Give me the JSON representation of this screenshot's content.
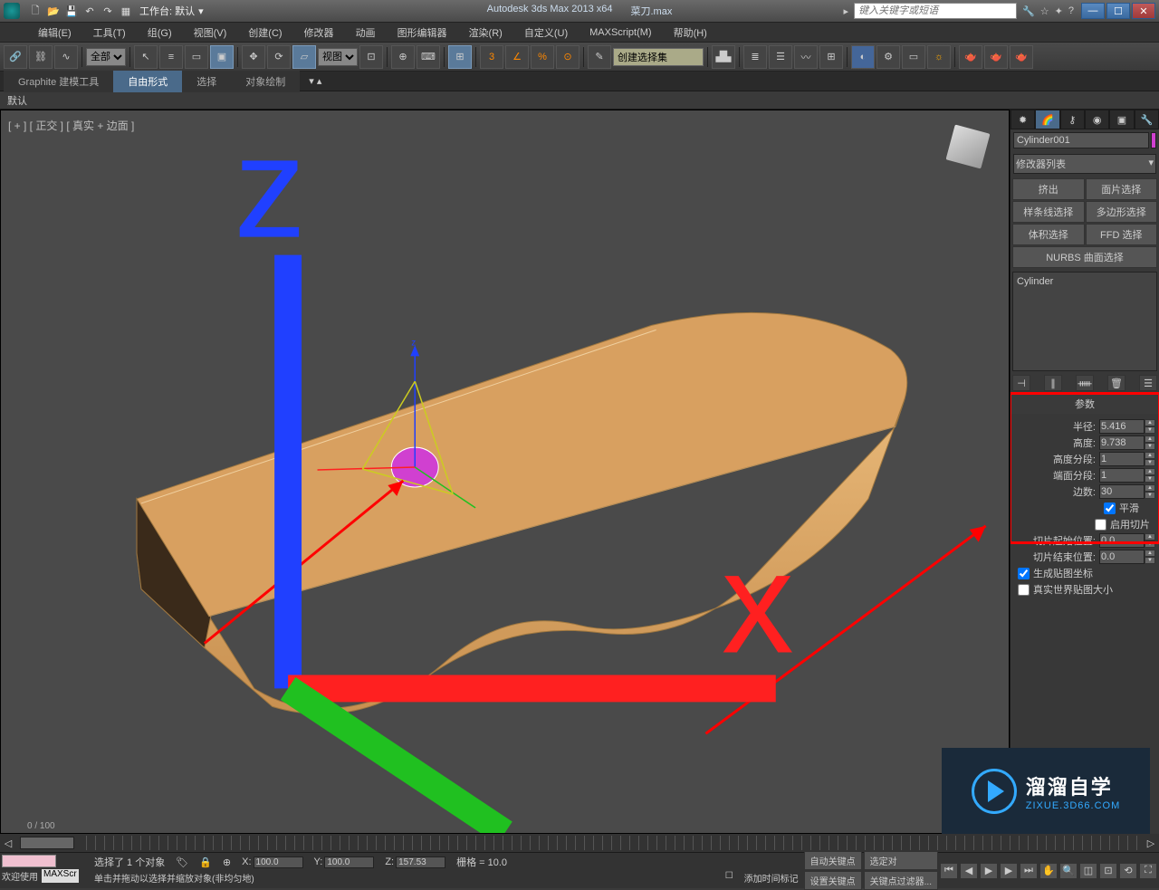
{
  "titlebar": {
    "workspace_label": "工作台: 默认",
    "app_title": "Autodesk 3ds Max  2013 x64",
    "filename": "菜刀.max",
    "search_placeholder": "键入关键字或短语"
  },
  "menus": [
    "编辑(E)",
    "工具(T)",
    "组(G)",
    "视图(V)",
    "创建(C)",
    "修改器",
    "动画",
    "图形编辑器",
    "渲染(R)",
    "自定义(U)",
    "MAXScript(M)",
    "帮助(H)"
  ],
  "toolbar": {
    "selection_filter": "全部",
    "ref_coord": "视图",
    "named_sel": "创建选择集"
  },
  "ribbon": {
    "tabs": [
      "Graphite 建模工具",
      "自由形式",
      "选择",
      "对象绘制"
    ],
    "active": "自由形式",
    "sub": "默认"
  },
  "viewport": {
    "label": "[ + ] [ 正交 ] [ 真实 + 边面 ]"
  },
  "cmdpanel": {
    "object_name": "Cylinder001",
    "modifier_list": "修改器列表",
    "buttons": [
      "挤出",
      "面片选择",
      "样条线选择",
      "多边形选择",
      "体积选择",
      "FFD 选择",
      "NURBS 曲面选择"
    ],
    "stack_item": "Cylinder",
    "rollout_title": "参数",
    "params": {
      "radius_label": "半径:",
      "radius": "5.416",
      "height_label": "高度:",
      "height": "9.738",
      "hseg_label": "高度分段:",
      "hseg": "1",
      "cseg_label": "端面分段:",
      "cseg": "1",
      "sides_label": "边数:",
      "sides": "30",
      "smooth": "平滑",
      "slice_on": "启用切片",
      "slice_from_label": "切片起始位置:",
      "slice_from": "0.0",
      "slice_to_label": "切片结束位置:",
      "slice_to": "0.0",
      "gen_uv": "生成贴图坐标",
      "real_world": "真实世界贴图大小"
    }
  },
  "timeline": {
    "frame": "0 / 100"
  },
  "status": {
    "welcome": "欢迎使用",
    "maxscr": "MAXScr",
    "sel_count": "选择了 1 个对象",
    "prompt": "单击并拖动以选择并缩放对象(非均匀地)",
    "x": "100.0",
    "y": "100.0",
    "z": "157.53",
    "grid": "栅格 = 10.0",
    "add_time_tag": "添加时间标记",
    "auto_key": "自动关键点",
    "set_key": "设置关键点",
    "sel_obj": "选定对",
    "key_filter": "关键点过滤器..."
  },
  "watermark": {
    "zh": "溜溜自学",
    "en": "ZIXUE.3D66.COM"
  }
}
